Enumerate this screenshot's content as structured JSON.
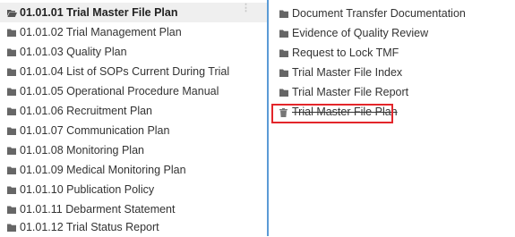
{
  "left_tree": {
    "items": [
      {
        "label": "01.01.01 Trial Master File Plan",
        "icon": "folder-open-icon",
        "selected": true
      },
      {
        "label": "01.01.02 Trial Management Plan",
        "icon": "folder-icon"
      },
      {
        "label": "01.01.03 Quality Plan",
        "icon": "folder-icon"
      },
      {
        "label": "01.01.04 List of SOPs Current During Trial",
        "icon": "folder-icon"
      },
      {
        "label": "01.01.05 Operational Procedure Manual",
        "icon": "folder-icon"
      },
      {
        "label": "01.01.06 Recruitment Plan",
        "icon": "folder-icon"
      },
      {
        "label": "01.01.07 Communication Plan",
        "icon": "folder-icon"
      },
      {
        "label": "01.01.08 Monitoring Plan",
        "icon": "folder-icon"
      },
      {
        "label": "01.01.09 Medical Monitoring Plan",
        "icon": "folder-icon"
      },
      {
        "label": "01.01.10 Publication Policy",
        "icon": "folder-icon"
      },
      {
        "label": "01.01.11 Debarment Statement",
        "icon": "folder-icon"
      },
      {
        "label": "01.01.12 Trial Status Report",
        "icon": "folder-icon"
      }
    ]
  },
  "right_list": {
    "items": [
      {
        "label": "Document Transfer Documentation",
        "icon": "folder-icon"
      },
      {
        "label": "Evidence of Quality Review",
        "icon": "folder-icon"
      },
      {
        "label": "Request to Lock TMF",
        "icon": "folder-icon"
      },
      {
        "label": "Trial Master File Index",
        "icon": "folder-icon"
      },
      {
        "label": "Trial Master File Report",
        "icon": "folder-icon"
      },
      {
        "label": "Trial Master File Plan",
        "icon": "trash-icon",
        "deleted": true,
        "highlighted": true
      }
    ]
  },
  "colors": {
    "divider": "#5b9bd5",
    "highlight_border": "#e3262b",
    "selected_row_bg": "#efefef",
    "icon": "#666666"
  }
}
